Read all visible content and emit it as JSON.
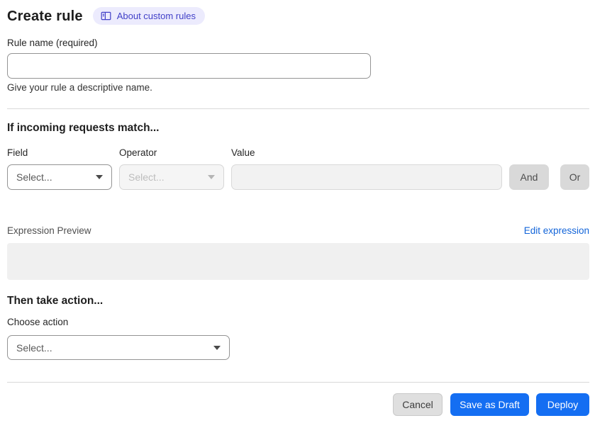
{
  "header": {
    "title": "Create rule",
    "about_badge": {
      "label": "About custom rules",
      "icon": "book-icon"
    }
  },
  "rule_name": {
    "label": "Rule name (required)",
    "value": "",
    "help": "Give your rule a descriptive name."
  },
  "match_section": {
    "heading": "If incoming requests match...",
    "field": {
      "label": "Field",
      "placeholder": "Select..."
    },
    "operator": {
      "label": "Operator",
      "placeholder": "Select...",
      "disabled": true
    },
    "value": {
      "label": "Value",
      "value": "",
      "disabled": true
    },
    "and_button": "And",
    "or_button": "Or",
    "expression_preview_label": "Expression Preview",
    "edit_expression_link": "Edit expression",
    "expression_value": ""
  },
  "action_section": {
    "heading": "Then take action...",
    "choose_action": {
      "label": "Choose action",
      "placeholder": "Select..."
    }
  },
  "footer": {
    "cancel": "Cancel",
    "save_draft": "Save as Draft",
    "deploy": "Deploy"
  },
  "colors": {
    "primary_blue": "#146ef2",
    "link_blue": "#1264d9",
    "badge_bg": "#ecebfd",
    "badge_text": "#4140c8",
    "gray_button": "#d9d9d9",
    "disabled_bg": "#f2f2f2",
    "divider": "#d9d9d9",
    "preview_box_bg": "#f0f0f0"
  }
}
